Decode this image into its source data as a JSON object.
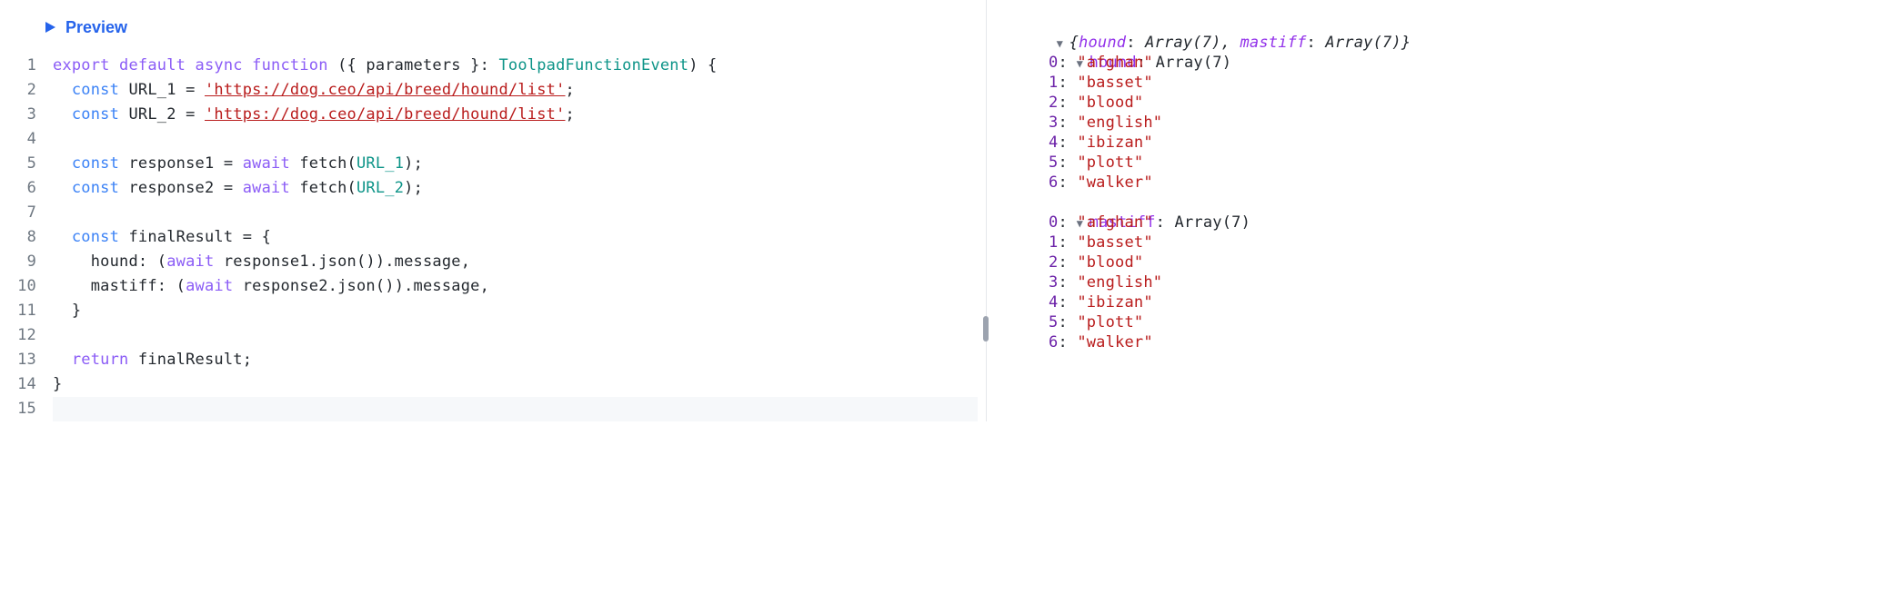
{
  "header": {
    "preview_label": "Preview"
  },
  "editor": {
    "line_numbers": [
      "1",
      "2",
      "3",
      "4",
      "5",
      "6",
      "7",
      "8",
      "9",
      "10",
      "11",
      "12",
      "13",
      "14",
      "15"
    ],
    "lines": {
      "l1": {
        "kw_export": "export",
        "kw_default": "default",
        "kw_async": "async",
        "kw_function": "function",
        "destruct": "({ parameters }:",
        "type": "ToolpadFunctionEvent",
        "tail": ") {"
      },
      "l2": {
        "kw_const": "const",
        "name": "URL_1",
        "eq": " = ",
        "str": "'https://dog.ceo/api/breed/hound/list'",
        "semi": ";"
      },
      "l3": {
        "kw_const": "const",
        "name": "URL_2",
        "eq": " = ",
        "str": "'https://dog.ceo/api/breed/hound/list'",
        "semi": ";"
      },
      "l5": {
        "kw_const": "const",
        "name": "response1",
        "eq": " = ",
        "kw_await": "await",
        "call": " fetch(",
        "arg": "URL_1",
        "tail": ");"
      },
      "l6": {
        "kw_const": "const",
        "name": "response2",
        "eq": " = ",
        "kw_await": "await",
        "call": " fetch(",
        "arg": "URL_2",
        "tail": ");"
      },
      "l8": {
        "kw_const": "const",
        "name": "finalResult",
        "eq": " = {"
      },
      "l9": {
        "indent": "    ",
        "key": "hound: (",
        "kw_await": "await",
        "rest": " response1.json()).message,"
      },
      "l10": {
        "indent": "    ",
        "key": "mastiff: (",
        "kw_await": "await",
        "rest": " response2.json()).message,"
      },
      "l11": {
        "text": "  }"
      },
      "l13": {
        "kw_return": "return",
        "rest": " finalResult;"
      },
      "l14": {
        "text": "}"
      }
    }
  },
  "inspector": {
    "root_summary_prefix": "{",
    "root_summary_k1": "hound",
    "root_summary_v1": "Array(7)",
    "root_summary_sep": ", ",
    "root_summary_k2": "mastiff",
    "root_summary_v2": "Array(7)",
    "root_summary_suffix": "}",
    "g1": {
      "key": "hound",
      "type": "Array(7)"
    },
    "g1_items": [
      {
        "idx": "0",
        "val": "\"afghan\""
      },
      {
        "idx": "1",
        "val": "\"basset\""
      },
      {
        "idx": "2",
        "val": "\"blood\""
      },
      {
        "idx": "3",
        "val": "\"english\""
      },
      {
        "idx": "4",
        "val": "\"ibizan\""
      },
      {
        "idx": "5",
        "val": "\"plott\""
      },
      {
        "idx": "6",
        "val": "\"walker\""
      }
    ],
    "g2": {
      "key": "mastiff",
      "type": "Array(7)"
    },
    "g2_items": [
      {
        "idx": "0",
        "val": "\"afghan\""
      },
      {
        "idx": "1",
        "val": "\"basset\""
      },
      {
        "idx": "2",
        "val": "\"blood\""
      },
      {
        "idx": "3",
        "val": "\"english\""
      },
      {
        "idx": "4",
        "val": "\"ibizan\""
      },
      {
        "idx": "5",
        "val": "\"plott\""
      },
      {
        "idx": "6",
        "val": "\"walker\""
      }
    ]
  }
}
